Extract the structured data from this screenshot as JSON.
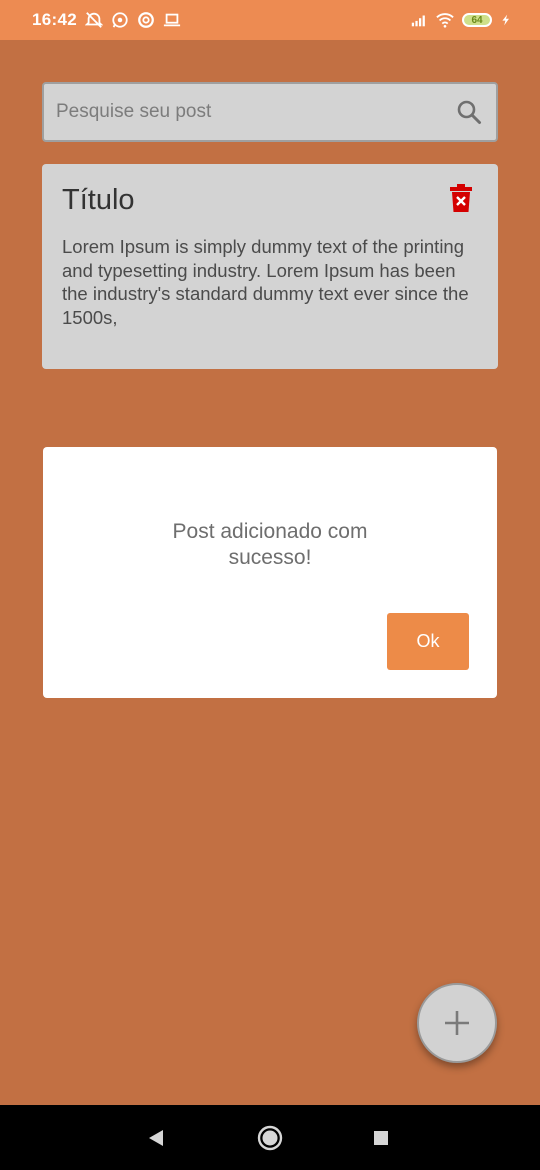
{
  "status_bar": {
    "time": "16:42",
    "battery": "64",
    "icons": [
      "alarm-off-icon",
      "whatsapp-icon",
      "app-notification-icon",
      "laptop-icon",
      "signal-icon",
      "wifi-icon",
      "battery-icon",
      "charging-icon"
    ]
  },
  "search": {
    "placeholder": "Pesquise seu post",
    "value": "",
    "icon": "search-icon"
  },
  "post": {
    "title": "Título",
    "body": "Lorem Ipsum is simply dummy text of the printing and typesetting industry. Lorem Ipsum has been the industry's standard dummy text ever since the 1500s,",
    "delete_icon": "trash-delete-icon"
  },
  "dialog": {
    "message_line1": "Post adicionado com",
    "message_line2": "sucesso!",
    "ok_label": "Ok"
  },
  "fab": {
    "icon": "plus-icon"
  },
  "nav": {
    "back": "back-icon",
    "home": "home-icon",
    "recents": "recents-icon"
  },
  "colors": {
    "status_bar": "#ed8b52",
    "background_dimmed": "#c27043",
    "card": "#d3d3d3",
    "accent": "#ed8b48",
    "delete": "#d40000"
  }
}
